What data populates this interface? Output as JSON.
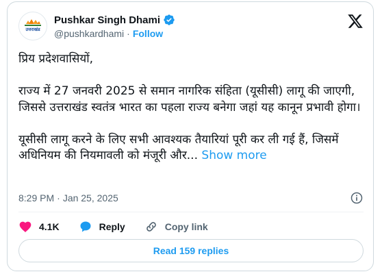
{
  "author": {
    "display_name": "Pushkar Singh Dhami",
    "handle": "@pushkardhami",
    "follow_label": "Follow",
    "avatar_text": "उत्तराखंड",
    "verified_color": "#1d9bf0"
  },
  "tweet": {
    "line1": "प्रिय प्रदेशवासियों,",
    "para2": "राज्य में 27 जनवरी 2025 से समान नागरिक संहिता (यूसीसी) लागू की जाएगी, जिससे उत्तराखंड स्वतंत्र भारत का पहला राज्य बनेगा जहां यह कानून प्रभावी होगा।",
    "para3": "यूसीसी लागू करने के लिए सभी आवश्यक तैयारियां पूरी कर ली गई हैं, जिसमें अधिनियम की नियमावली को मंजूरी और...",
    "show_more": "Show more",
    "time": "8:29 PM",
    "date": "Jan 25, 2025"
  },
  "actions": {
    "likes": "4.1K",
    "reply_label": "Reply",
    "copy_link_label": "Copy link",
    "like_color": "#f91880",
    "reply_color": "#1d9bf0"
  },
  "replies_button": "Read 159 replies"
}
